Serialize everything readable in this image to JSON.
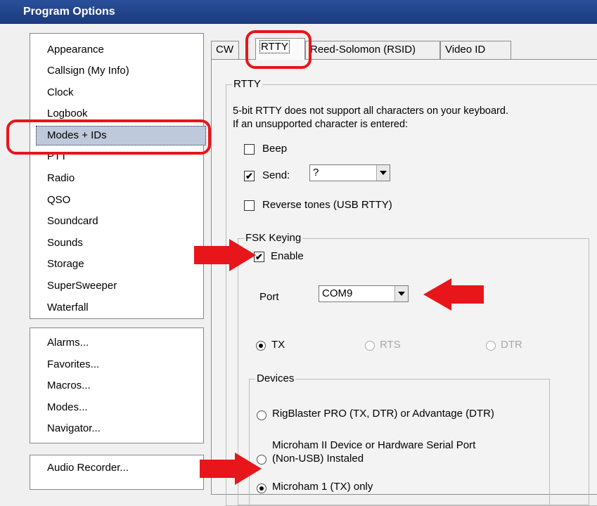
{
  "window": {
    "title": "Program Options"
  },
  "left": {
    "categories": [
      "Appearance",
      "Callsign (My Info)",
      "Clock",
      "Logbook",
      "Modes + IDs",
      "PTT",
      "Radio",
      "QSO",
      "Soundcard",
      "Sounds",
      "Storage",
      "SuperSweeper",
      "Waterfall"
    ],
    "selected_category": "Modes + IDs",
    "dialogs": [
      "Alarms...",
      "Favorites...",
      "Macros...",
      "Modes...",
      "Navigator..."
    ],
    "tools": [
      "Audio Recorder..."
    ]
  },
  "tabs": [
    "CW",
    "RTTY",
    "Reed-Solomon (RSID)",
    "Video ID"
  ],
  "active_tab": "RTTY",
  "rtty": {
    "group_title": "RTTY",
    "note_line1": "5-bit RTTY does not support all characters on your keyboard.",
    "note_line2": "If an unsupported character  is entered:",
    "beep_label": "Beep",
    "send_label": "Send:",
    "send_value": "?",
    "reverse_label": "Reverse tones (USB RTTY)"
  },
  "fsk": {
    "group_title": "FSK Keying",
    "enable_label": "Enable",
    "port_label": "Port",
    "port_value": "COM9",
    "tx_label": "TX",
    "rts_label": "RTS",
    "dtr_label": "DTR"
  },
  "devices": {
    "group_title": "Devices",
    "opt1": "RigBlaster PRO (TX, DTR) or Advantage (DTR)",
    "opt2_line1": "Microham II Device or Hardware Serial Port",
    "opt2_line2": "(Non-USB) Instaled",
    "opt3": "Microham 1 (TX) only"
  },
  "check_mark": "✔",
  "annotation_color": "#e8151b"
}
